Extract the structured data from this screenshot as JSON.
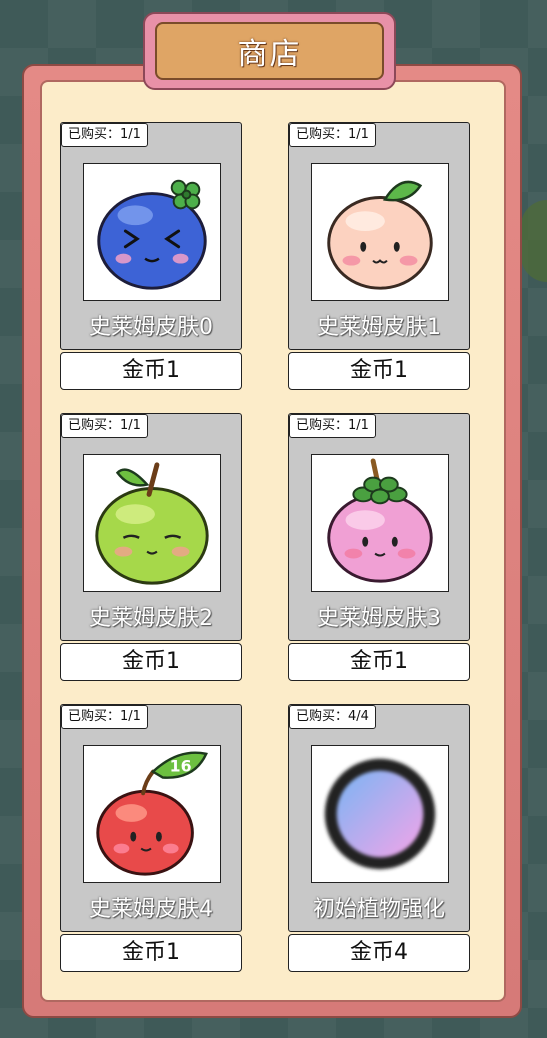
{
  "shop": {
    "title": "商店",
    "items": [
      {
        "purchased": "已购买：1/1",
        "name": "史莱姆皮肤0",
        "price": "金币1",
        "icon": "blue-slime-icon"
      },
      {
        "purchased": "已购买：1/1",
        "name": "史莱姆皮肤1",
        "price": "金币1",
        "icon": "peach-slime-icon"
      },
      {
        "purchased": "已购买：1/1",
        "name": "史莱姆皮肤2",
        "price": "金币1",
        "icon": "green-apple-slime-icon"
      },
      {
        "purchased": "已购买：1/1",
        "name": "史莱姆皮肤3",
        "price": "金币1",
        "icon": "mangosteen-slime-icon"
      },
      {
        "purchased": "已购买：1/1",
        "name": "史莱姆皮肤4",
        "price": "金币1",
        "icon": "red-apple-slime-icon"
      },
      {
        "purchased": "已购买：4/4",
        "name": "初始植物强化",
        "price": "金币4",
        "icon": "enhance-orb-icon"
      }
    ],
    "apple_badge": "16"
  }
}
